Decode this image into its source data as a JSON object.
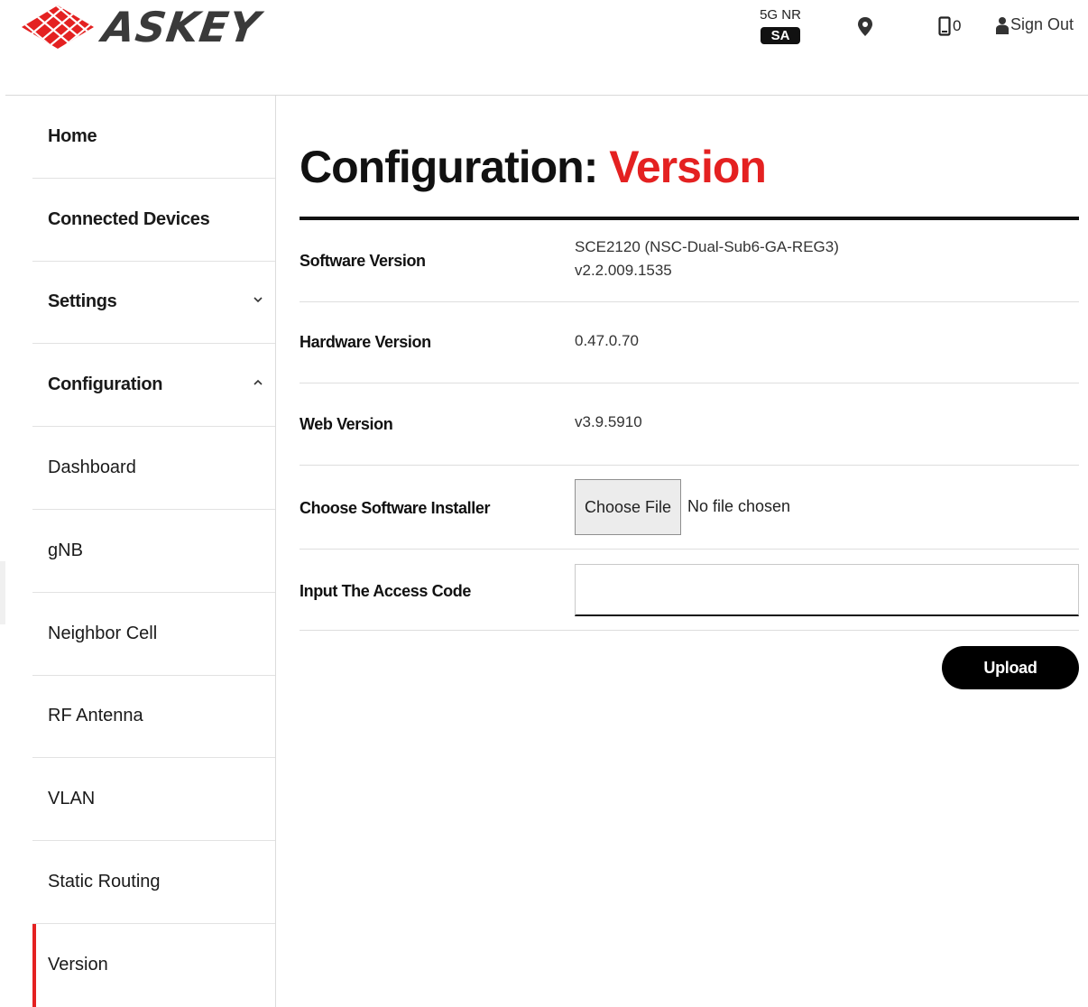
{
  "header": {
    "brand": "ASKEY",
    "network": {
      "label": "5G NR",
      "badge": "SA"
    },
    "location_icon": "map-pin-icon",
    "device_icon": "phone-icon",
    "device_count": "0",
    "signout_icon": "user-icon",
    "signout_label": "Sign Out"
  },
  "sidebar": {
    "items": [
      {
        "label": "Home"
      },
      {
        "label": "Connected Devices"
      },
      {
        "label": "Settings",
        "icon": "chevron-down-icon"
      },
      {
        "label": "Configuration",
        "icon": "chevron-up-icon"
      },
      {
        "label": "Dashboard"
      },
      {
        "label": "gNB"
      },
      {
        "label": "Neighbor Cell"
      },
      {
        "label": "RF Antenna"
      },
      {
        "label": "VLAN"
      },
      {
        "label": "Static Routing"
      },
      {
        "label": "Version",
        "active": true
      }
    ]
  },
  "main": {
    "title_prefix": "Configuration:",
    "title_accent": "Version",
    "rows": [
      {
        "label": "Software Version",
        "value_line1": "SCE2120 (NSC-Dual-Sub6-GA-REG3)",
        "value_line2": "v2.2.009.1535"
      },
      {
        "label": "Hardware Version",
        "value": "0.47.0.70"
      },
      {
        "label": "Web Version",
        "value": "v3.9.5910"
      },
      {
        "label": "Choose Software Installer",
        "button_label": "Choose File",
        "status": "No file chosen"
      },
      {
        "label": "Input The Access Code",
        "input_value": ""
      }
    ],
    "upload_label": "Upload"
  },
  "colors": {
    "accent": "#e42121",
    "text": "#111111",
    "button_bg": "#000000",
    "button_text": "#ffffff",
    "sa_badge_bg": "#111111"
  }
}
